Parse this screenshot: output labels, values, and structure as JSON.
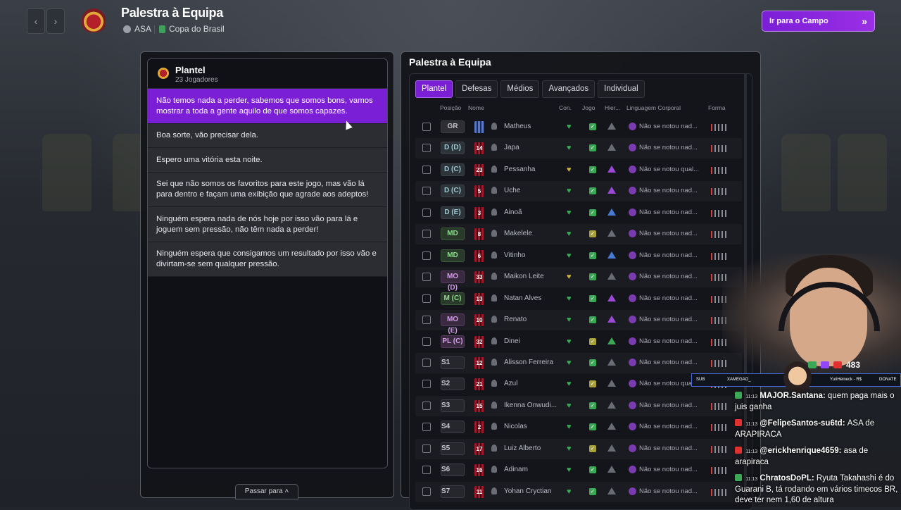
{
  "header": {
    "title": "Palestra à Equipa",
    "club": "ASA",
    "competition": "Copa do Brasil",
    "go_button": "Ir para o Campo"
  },
  "left_panel": {
    "title": "Plantel",
    "subtitle": "23 Jogadores",
    "talks": [
      "Não temos nada a perder, sabemos que somos bons, vamos mostrar a toda a gente aquilo de que somos capazes.",
      "Boa sorte, vão precisar dela.",
      "Espero uma vitória esta noite.",
      "Sei que não somos os favoritos para este jogo, mas vão lá para dentro e façam uma exibição que agrade aos adeptos!",
      "Ninguém espera nada de nós hoje por isso vão para lá e joguem sem pressão, não têm nada a perder!",
      "Ninguém espera que consigamos um resultado por isso vão e divirtam-se sem qualquer pressão."
    ],
    "passar": "Passar para"
  },
  "right_panel": {
    "title": "Palestra à Equipa",
    "tabs": [
      "Plantel",
      "Defesas",
      "Médios",
      "Avançados",
      "Individual"
    ],
    "columns": [
      "Posição",
      "Nome",
      "Con.",
      "Jogo",
      "Hier...",
      "Linguagem Corporal",
      "Forma"
    ],
    "players": [
      {
        "pos": "GR",
        "num": "",
        "name": "Matheus",
        "lang": "Não se notou nad...",
        "hier": "n",
        "heart": "#3aa855",
        "jogo": "g"
      },
      {
        "pos": "D (D)",
        "num": "14",
        "name": "Japa",
        "lang": "Não se notou nad...",
        "hier": "n",
        "heart": "#3aa855",
        "jogo": "g"
      },
      {
        "pos": "D (C)",
        "num": "23",
        "name": "Pessanha",
        "lang": "Não se notou qual...",
        "hier": "p",
        "heart": "#c8b040",
        "jogo": "g"
      },
      {
        "pos": "D (C)",
        "num": "5",
        "name": "Uche",
        "lang": "Não se notou nad...",
        "hier": "p",
        "heart": "#3aa855",
        "jogo": "g"
      },
      {
        "pos": "D (E)",
        "num": "3",
        "name": "Ainoã",
        "lang": "Não se notou nad...",
        "hier": "b",
        "heart": "#3aa855",
        "jogo": "g"
      },
      {
        "pos": "MD",
        "num": "8",
        "name": "Makelele",
        "lang": "Não se notou nad...",
        "hier": "n",
        "heart": "#3aa855",
        "jogo": "y"
      },
      {
        "pos": "MD",
        "num": "6",
        "name": "Vitinho",
        "lang": "Não se notou nad...",
        "hier": "b",
        "heart": "#3aa855",
        "jogo": "g"
      },
      {
        "pos": "MO (D)",
        "num": "33",
        "name": "Maikon Leite",
        "lang": "Não se notou nad...",
        "hier": "n",
        "heart": "#c8b040",
        "jogo": "g"
      },
      {
        "pos": "M (C)",
        "num": "13",
        "name": "Natan Alves",
        "lang": "Não se notou nad...",
        "hier": "p",
        "heart": "#3aa855",
        "jogo": "g"
      },
      {
        "pos": "MO (E)",
        "num": "10",
        "name": "Renato",
        "lang": "Não se notou nad...",
        "hier": "p",
        "heart": "#3aa855",
        "jogo": "g"
      },
      {
        "pos": "PL (C)",
        "num": "32",
        "name": "Dinei",
        "lang": "Não se notou nad...",
        "hier": "g",
        "heart": "#3aa855",
        "jogo": "y"
      },
      {
        "pos": "S1",
        "num": "12",
        "name": "Alisson Ferreira",
        "lang": "Não se notou nad...",
        "hier": "n",
        "heart": "#3aa855",
        "jogo": "g"
      },
      {
        "pos": "S2",
        "num": "21",
        "name": "Azul",
        "lang": "Não se notou qual...",
        "hier": "n",
        "heart": "#3aa855",
        "jogo": "y"
      },
      {
        "pos": "S3",
        "num": "15",
        "name": "Ikenna Onwudi...",
        "lang": "Não se notou nad...",
        "hier": "n",
        "heart": "#3aa855",
        "jogo": "g"
      },
      {
        "pos": "S4",
        "num": "2",
        "name": "Nicolas",
        "lang": "Não se notou nad...",
        "hier": "n",
        "heart": "#3aa855",
        "jogo": "g"
      },
      {
        "pos": "S5",
        "num": "17",
        "name": "Luiz Alberto",
        "lang": "Não se notou nad...",
        "hier": "n",
        "heart": "#3aa855",
        "jogo": "y"
      },
      {
        "pos": "S6",
        "num": "16",
        "name": "Adinam",
        "lang": "Não se notou nad...",
        "hier": "n",
        "heart": "#3aa855",
        "jogo": "g"
      },
      {
        "pos": "S7",
        "num": "11",
        "name": "Yohan Cryctian",
        "lang": "Não se notou nad...",
        "hier": "n",
        "heart": "#3aa855",
        "jogo": "g"
      }
    ]
  },
  "stream": {
    "viewers": "483",
    "banner_left": "XAMEGAO_",
    "banner_right": "YuriHeineck - R$",
    "banner_sub": "SUB",
    "banner_donate": "DONATE",
    "chat": [
      {
        "time": "11:13",
        "user": "MAJOR.Santana:",
        "text": "quem paga mais o juis ganha",
        "color": "#3aa855"
      },
      {
        "time": "11:13",
        "user": "@FelipeSantos-su6td:",
        "text": "ASA de ARAPIRACA",
        "color": "#e03030"
      },
      {
        "time": "11:13",
        "user": "@erickhenrique4659:",
        "text": "asa de arapiraca",
        "color": "#e03030"
      },
      {
        "time": "11:13",
        "user": "ChratosDoPL:",
        "text": "Ryuta Takahashi é do Guarani B, tá rodando em vários timecos BR, deve ter nem 1,60 de altura",
        "color": "#3aa855"
      }
    ]
  }
}
